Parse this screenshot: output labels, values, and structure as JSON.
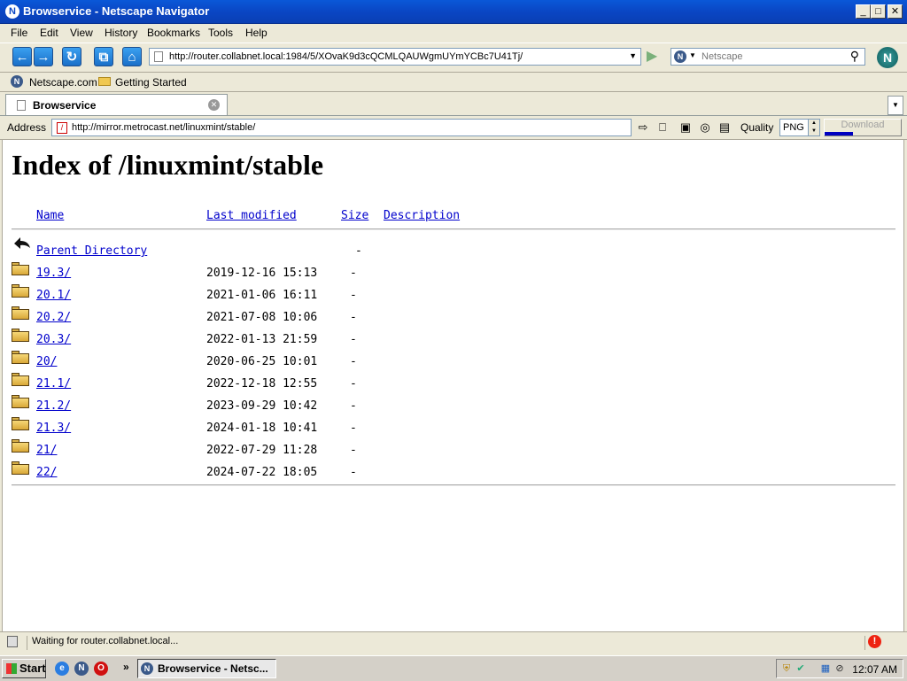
{
  "window": {
    "title": "Browservice - Netscape Navigator",
    "controls": {
      "minimize": "_",
      "maximize": "□",
      "close": "✕"
    }
  },
  "menu": [
    "File",
    "Edit",
    "View",
    "History",
    "Bookmarks",
    "Tools",
    "Help"
  ],
  "navbar": {
    "url": "http://router.collabnet.local:1984/5/XOvaK9d3cQCMLQAUWgmUYmYCBc7U41Tj/",
    "search_placeholder": "Netscape"
  },
  "bookmarks": [
    "Netscape.com",
    "Getting Started"
  ],
  "tab": {
    "label": "Browservice"
  },
  "addressbar": {
    "label": "Address",
    "url": "http://mirror.metrocast.net/linuxmint/stable/",
    "quality_label": "Quality",
    "quality_value": "PNG",
    "download_label": "Download"
  },
  "page": {
    "heading": "Index of /linuxmint/stable",
    "columns": {
      "name": "Name",
      "modified": "Last modified",
      "size": "Size",
      "description": "Description"
    },
    "parent": {
      "name": "Parent Directory",
      "size": "-"
    },
    "rows": [
      {
        "name": "19.3/",
        "modified": "2019-12-16 15:13",
        "size": "-"
      },
      {
        "name": "20.1/",
        "modified": "2021-01-06 16:11",
        "size": "-"
      },
      {
        "name": "20.2/",
        "modified": "2021-07-08 10:06",
        "size": "-"
      },
      {
        "name": "20.3/",
        "modified": "2022-01-13 21:59",
        "size": "-"
      },
      {
        "name": "20/",
        "modified": "2020-06-25 10:01",
        "size": "-"
      },
      {
        "name": "21.1/",
        "modified": "2022-12-18 12:55",
        "size": "-"
      },
      {
        "name": "21.2/",
        "modified": "2023-09-29 10:42",
        "size": "-"
      },
      {
        "name": "21.3/",
        "modified": "2024-01-18 10:41",
        "size": "-"
      },
      {
        "name": "21/",
        "modified": "2022-07-29 11:28",
        "size": "-"
      },
      {
        "name": "22/",
        "modified": "2024-07-22 18:05",
        "size": "-"
      }
    ]
  },
  "status": {
    "text": "Waiting for router.collabnet.local..."
  },
  "taskbar": {
    "start_label": "Start",
    "overflow": "»",
    "task_label": "Browservice - Netsc...",
    "clock": "12:07 AM"
  }
}
